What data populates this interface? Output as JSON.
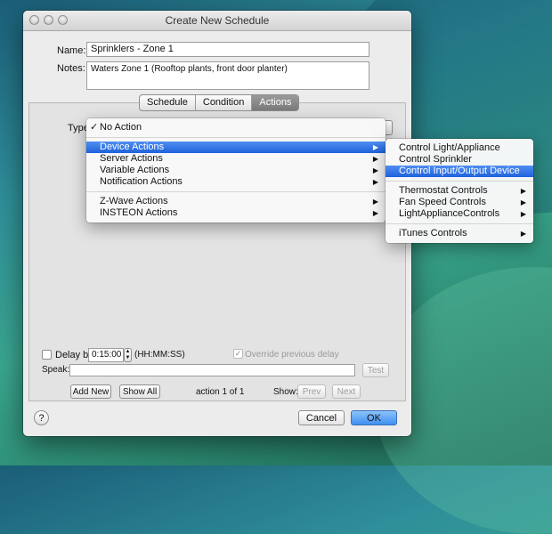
{
  "window": {
    "title": "Create New Schedule"
  },
  "form": {
    "name_label": "Name:",
    "name_value": "Sprinklers - Zone 1",
    "notes_label": "Notes:",
    "notes_value": "Waters Zone 1 (Rooftop plants, front door planter)"
  },
  "tabs": [
    "Schedule",
    "Condition",
    "Actions"
  ],
  "type_label": "Type:",
  "menu": {
    "check": "✓",
    "no_action": "No Action",
    "items": [
      "Device Actions",
      "Server Actions",
      "Variable Actions",
      "Notification Actions"
    ],
    "items2": [
      "Z-Wave Actions",
      "INSTEON Actions"
    ]
  },
  "submenu": {
    "items": [
      "Control Light/Appliance",
      "Control Sprinkler",
      "Control Input/Output Device"
    ],
    "items2": [
      "Thermostat Controls",
      "Fan Speed Controls",
      "LightApplianceControls"
    ],
    "items3": [
      "iTunes Controls"
    ]
  },
  "delay": {
    "label": "Delay by",
    "value": "0:15:00",
    "format": "(HH:MM:SS)",
    "override_label": "Override previous delay"
  },
  "speak": {
    "label": "Speak:",
    "test_label": "Test"
  },
  "footer": {
    "add_new": "Add New",
    "show_all": "Show All",
    "action_counter": "action 1 of 1",
    "show_label": "Show:",
    "prev": "Prev",
    "next": "Next"
  },
  "bottom": {
    "help": "?",
    "cancel": "Cancel",
    "ok": "OK"
  },
  "colors": {
    "highlight": "#2a6be0",
    "ok_button": "#5aa0f2"
  }
}
